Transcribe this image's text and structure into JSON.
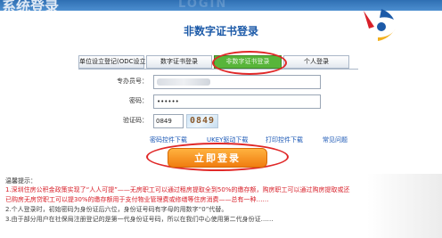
{
  "header": {
    "system_title": "系统登录",
    "watermark_text": "LOGIN"
  },
  "page": {
    "title": "非数字证书登录"
  },
  "tabs": [
    {
      "label": "单位设立登记(ODC设立)",
      "active": false
    },
    {
      "label": "数字证书登录",
      "active": false
    },
    {
      "label": "非数字证书登录",
      "active": true
    },
    {
      "label": "个人登录",
      "active": false
    }
  ],
  "form": {
    "account_label": "专办员号：",
    "password_label": "密码：",
    "password_value": "••••••",
    "captcha_label": "验证码：",
    "captcha_value": "0849",
    "captcha_image_text": "0849"
  },
  "links": {
    "control_download": "密码控件下载",
    "ukey_driver": "UKEY驱动下载",
    "print_control": "打印控件下载",
    "faq": "常见问题"
  },
  "login_button": "立即登录",
  "tips": {
    "title": "温馨提示：",
    "line1": "1.深圳住房公积金政策实现了“人人可提”——无房职工可以通过租房提取全到50%的缴存额，购房职工可以通过购房提取或还",
    "line2": "已购房无房贷职工可以提30%的缴存额用于支付物业管理费或修缮等住房消费——总有一种……",
    "line3": "2.个人登录时，初始密码为身份证后六位，身份证号码有字母的用数字“0”代替。",
    "line4": "3.由于部分用户在社保局注册登记的是第一代身份证号码，所以在我们中心使用第二代身份证……"
  },
  "colors": {
    "accent_blue": "#1c5aa8",
    "active_tab_green": "#58b53a",
    "button_orange": "#f07d10",
    "annotation_red": "#e02828"
  }
}
